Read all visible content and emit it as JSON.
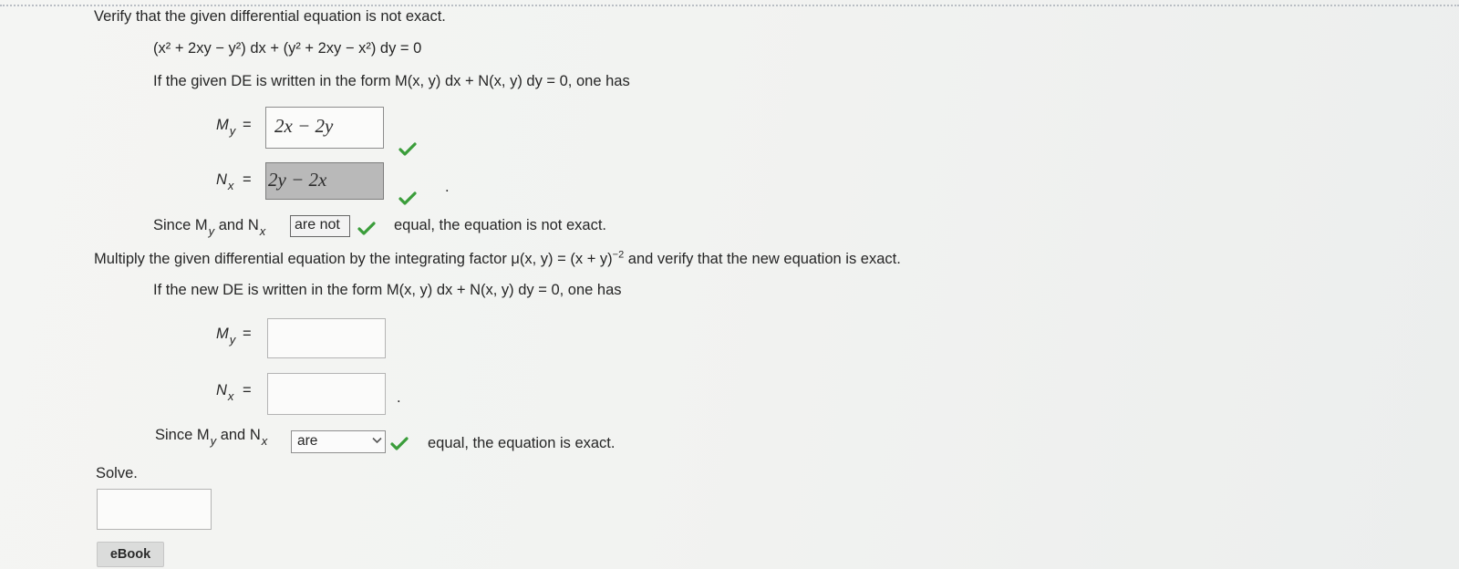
{
  "question": {
    "prompt": "Verify that the given differential equation is not exact.",
    "equation": "(x² + 2xy − y²) dx + (y² + 2xy − x²) dy = 0",
    "form_line": "If the given DE is written in the form M(x, y) dx + N(x, y) dy = 0, one has"
  },
  "part1": {
    "My_value": "2x − 2y",
    "Nx_value": "2y − 2x",
    "since_start": "Since M",
    "and": "and N",
    "dropdown_value": "are not",
    "since_end": "equal, the equation is not exact."
  },
  "part2": {
    "instruction_a": "Multiply the given differential equation by the integrating factor μ(x, y) = (x + y)",
    "exponent": "−2",
    "instruction_b": "and verify that the new equation is exact.",
    "form_line": "If the new DE is written in the form M(x, y) dx + N(x, y) dy = 0, one has",
    "My_value": "",
    "Nx_value": "",
    "since_start": "Since M",
    "and": "and N",
    "dropdown_value": "are",
    "since_end": "equal, the equation is exact."
  },
  "labels": {
    "M": "M",
    "N": "N",
    "y": "y",
    "x": "x",
    "eq": "=",
    "period": "."
  },
  "solve": {
    "label": "Solve.",
    "answer": ""
  },
  "ebook_label": "eBook",
  "colors": {
    "check_green": "#3a9d3a",
    "background": "#f2f3f1",
    "box_border": "#b4b4b4"
  }
}
